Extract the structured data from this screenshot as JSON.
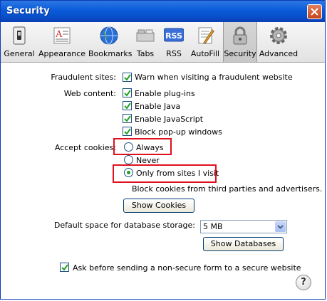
{
  "window": {
    "title": "Security"
  },
  "toolbar": {
    "items": [
      {
        "label": "General",
        "icon": "general-switch-icon"
      },
      {
        "label": "Appearance",
        "icon": "appearance-icon"
      },
      {
        "label": "Bookmarks",
        "icon": "bookmarks-globe-icon"
      },
      {
        "label": "Tabs",
        "icon": "tabs-icon"
      },
      {
        "label": "RSS",
        "icon": "rss-icon"
      },
      {
        "label": "AutoFill",
        "icon": "autofill-icon"
      },
      {
        "label": "Security",
        "icon": "lock-icon",
        "selected": true
      },
      {
        "label": "Advanced",
        "icon": "gear-icon"
      }
    ],
    "rss_badge": "RSS"
  },
  "fraudulent": {
    "label": "Fraudulent sites:",
    "option": "Warn when visiting a fraudulent website",
    "checked": true
  },
  "web_content": {
    "label": "Web content:",
    "options": [
      {
        "text": "Enable plug-ins",
        "checked": true
      },
      {
        "text": "Enable Java",
        "checked": true
      },
      {
        "text": "Enable JavaScript",
        "checked": true
      },
      {
        "text": "Block pop-up windows",
        "checked": true
      }
    ]
  },
  "cookies": {
    "label": "Accept cookies:",
    "options": [
      {
        "text": "Always",
        "selected": false
      },
      {
        "text": "Never",
        "selected": false
      },
      {
        "text": "Only from sites I visit",
        "selected": true
      }
    ],
    "note": "Block cookies from third parties and advertisers.",
    "show_button": "Show Cookies"
  },
  "database": {
    "label": "Default space for database storage:",
    "value": "5 MB",
    "show_button": "Show Databases"
  },
  "nonsecure": {
    "text": "Ask before sending a non-secure form to a secure website",
    "checked": true
  },
  "help": {
    "label": "?"
  },
  "colors": {
    "titlebar": "#0a5ad8",
    "highlight": "#e0101f",
    "radio_selected": "#21a121"
  }
}
